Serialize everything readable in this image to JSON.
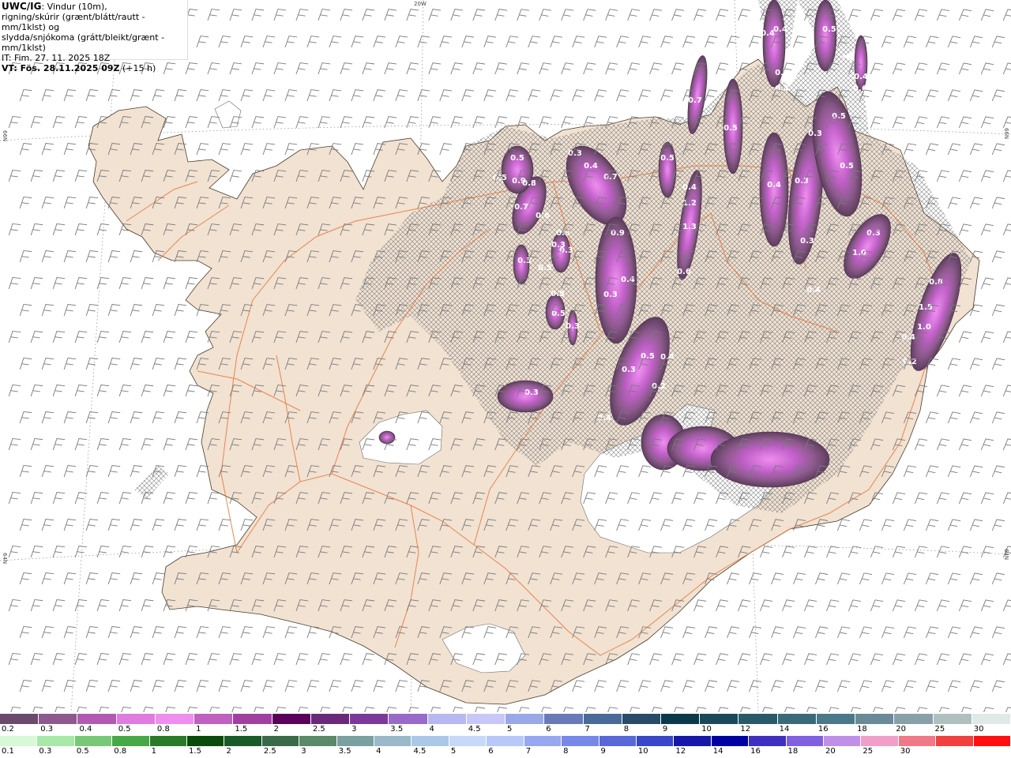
{
  "header": {
    "product": "UWC/IG",
    "line1_rest": ": Vindur (10m),",
    "line2": "rigning/skúrir (grænt/blátt/rautt - mm/1klst) og",
    "line3": "slydda/snjókoma (grátt/bleikt/grænt - mm/1klst)",
    "line4": "IT: Fim. 27. 11. 2025 18Z",
    "line5_bold": "VT: Fös. 28.11.2025 09Z",
    "line5_rest": " (+15 h)"
  },
  "axis_labels": {
    "top": "20W",
    "left_upper": "66N",
    "right_upper": "66N",
    "left_lower": "64N",
    "right_lower": "64N"
  },
  "colors": {
    "land": "#f1e2d2",
    "roads": "#e8743a",
    "coast": "#5a4a3a",
    "glacier": "#ffffff",
    "wind_barbs": "#7a7a7a"
  },
  "precip_values": [
    "0.4",
    "0.4",
    "0.5",
    "0.3",
    "0.4",
    "0.4",
    "0.7",
    "0.6",
    "0.5",
    "0.5",
    "0.7",
    "0.4",
    "1.2",
    "1.3",
    "0.5",
    "0.3",
    "0.5",
    "0.3",
    "0.4",
    "0.4",
    "0.3",
    "0.3",
    "0.4",
    "0.3",
    "1.0",
    "0.8",
    "1.5",
    "1.0",
    "0.4",
    "0.2",
    "0.7",
    "0.6",
    "0.8",
    "0.9",
    "0.5",
    "0.5",
    "0.3",
    "0.3",
    "0.3",
    "0.3",
    "0.5",
    "0.5",
    "0.5",
    "0.3",
    "0.9",
    "0.4",
    "0.3",
    "0.6",
    "0.5",
    "0.4",
    "0.3",
    "0.2",
    "0.4",
    "0.3"
  ],
  "legend_snow": {
    "labels": [
      "0.2",
      "0.3",
      "0.4",
      "0.5",
      "0.8",
      "1",
      "1.5",
      "2",
      "2.5",
      "3",
      "3.5",
      "4",
      "4.5",
      "5",
      "6",
      "7",
      "8",
      "9",
      "10",
      "12",
      "14",
      "16",
      "18",
      "20",
      "25",
      "30"
    ],
    "colors": [
      "#6b4a6b",
      "#8c5a8c",
      "#b25ab2",
      "#e07be0",
      "#f08ef0",
      "#c060c0",
      "#a040a0",
      "#5a005a",
      "#6a2a7a",
      "#7a3a9a",
      "#9a6ac8",
      "#b8b8f0",
      "#c8c8f8",
      "#9aa8e8",
      "#6a7ab8",
      "#4a6a98",
      "#2a4a6a",
      "#0a3a4a",
      "#1a4a5a",
      "#2a5a6a",
      "#3a6a7a",
      "#4a7a8a",
      "#6a8a98",
      "#8aa0a8",
      "#b0c0c0",
      "#e0e8e8"
    ]
  },
  "legend_rain": {
    "labels": [
      "0.1",
      "0.3",
      "0.5",
      "0.8",
      "1",
      "1.5",
      "2",
      "2.5",
      "3",
      "3.5",
      "4",
      "4.5",
      "5",
      "6",
      "7",
      "8",
      "9",
      "10",
      "12",
      "14",
      "16",
      "18",
      "20",
      "25",
      "30"
    ],
    "colors": [
      "#d8f8d8",
      "#a8e8a8",
      "#78c878",
      "#48a848",
      "#2a7a2a",
      "#0a4a0a",
      "#1a5a2a",
      "#3a6a4a",
      "#5a8a6a",
      "#7aa0a0",
      "#9ab8c8",
      "#aac8e8",
      "#c8d8f8",
      "#b8c8f8",
      "#98a8f0",
      "#7888e8",
      "#5868d8",
      "#3848c8",
      "#1818a8",
      "#0000a0",
      "#4030c0",
      "#8060e0",
      "#c090e8",
      "#f0a0c8",
      "#f07888",
      "#f04040",
      "#ff1010"
    ]
  }
}
